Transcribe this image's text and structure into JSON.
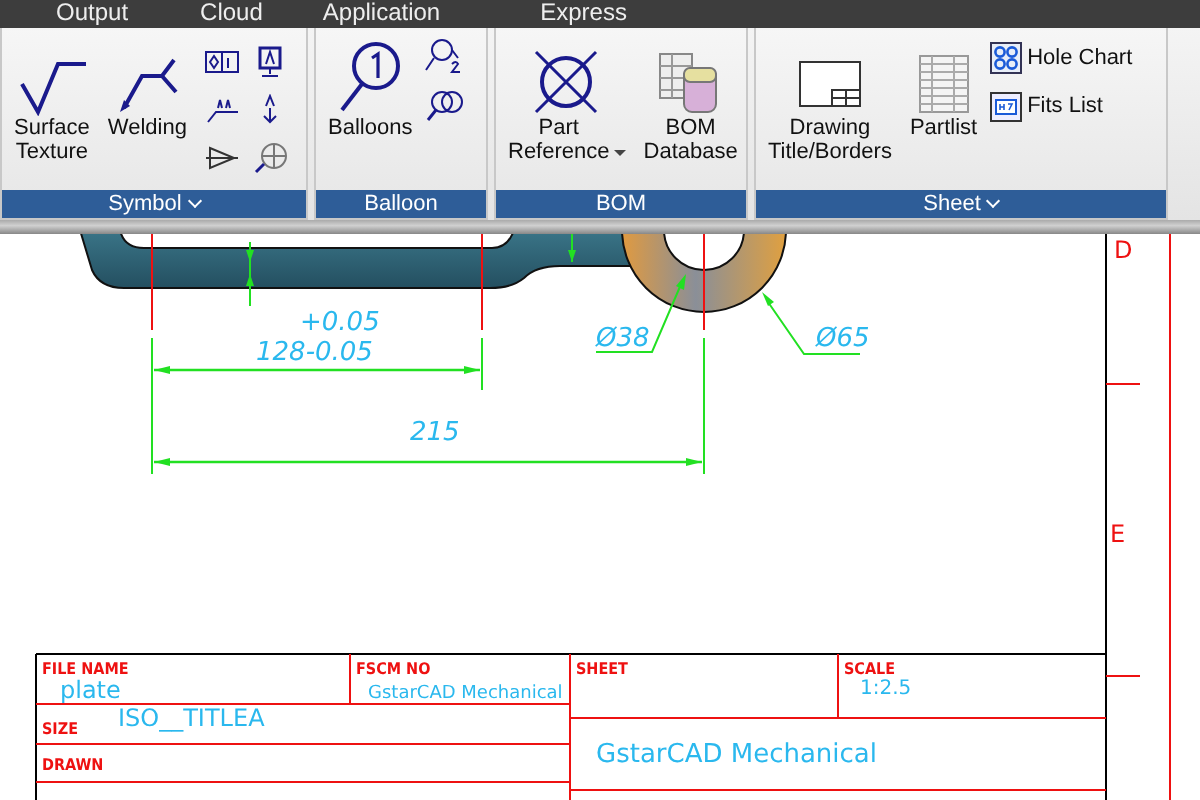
{
  "menu": [
    {
      "label": "Output"
    },
    {
      "label": "Cloud"
    },
    {
      "label": "Application"
    },
    {
      "label": "Express"
    }
  ],
  "ribbon": {
    "panels": [
      {
        "title": "Symbol",
        "has_menu": true,
        "buttons": [
          {
            "kind": "large",
            "label": "Surface\nTexture",
            "has_menu": false
          },
          {
            "kind": "large",
            "label": "Welding",
            "has_menu": false
          },
          {
            "kind": "icongrid"
          }
        ]
      },
      {
        "title": "Balloon",
        "has_menu": false,
        "buttons": [
          {
            "kind": "large",
            "label": "Balloons",
            "has_menu": false
          },
          {
            "kind": "iconcol"
          }
        ]
      },
      {
        "title": "BOM",
        "has_menu": false,
        "buttons": [
          {
            "kind": "large",
            "label": "Part\nReference",
            "has_menu": true
          },
          {
            "kind": "large",
            "label": "BOM\nDatabase",
            "has_menu": false
          }
        ]
      },
      {
        "title": "Sheet",
        "has_menu": true,
        "buttons": [
          {
            "kind": "large",
            "label": "Drawing\nTitle/Borders",
            "has_menu": false
          },
          {
            "kind": "large",
            "label": "Partlist",
            "has_menu": false
          },
          {
            "kind": "small",
            "items": [
              {
                "label": "Hole Chart"
              },
              {
                "label": "Fits List"
              }
            ]
          }
        ]
      }
    ]
  },
  "drawing": {
    "dimensions": {
      "tolerance": "+0.05",
      "length": "128-0.05",
      "overall": "215",
      "hole_dia": "Ø38",
      "outer_dia": "Ø65"
    },
    "border_letters": [
      "D",
      "E"
    ],
    "title_block": {
      "file_name_label": "FILE NAME",
      "file_name": "plate",
      "fscm_label": "FSCM NO",
      "fscm": "GstarCAD Mechanical",
      "sheet_label": "SHEET",
      "scale_label": "SCALE",
      "scale": "1:2.5",
      "size_label": "SIZE",
      "size": "ISO__TITLEA",
      "drawn_label": "DRAWN",
      "title": "GstarCAD Mechanical"
    }
  }
}
